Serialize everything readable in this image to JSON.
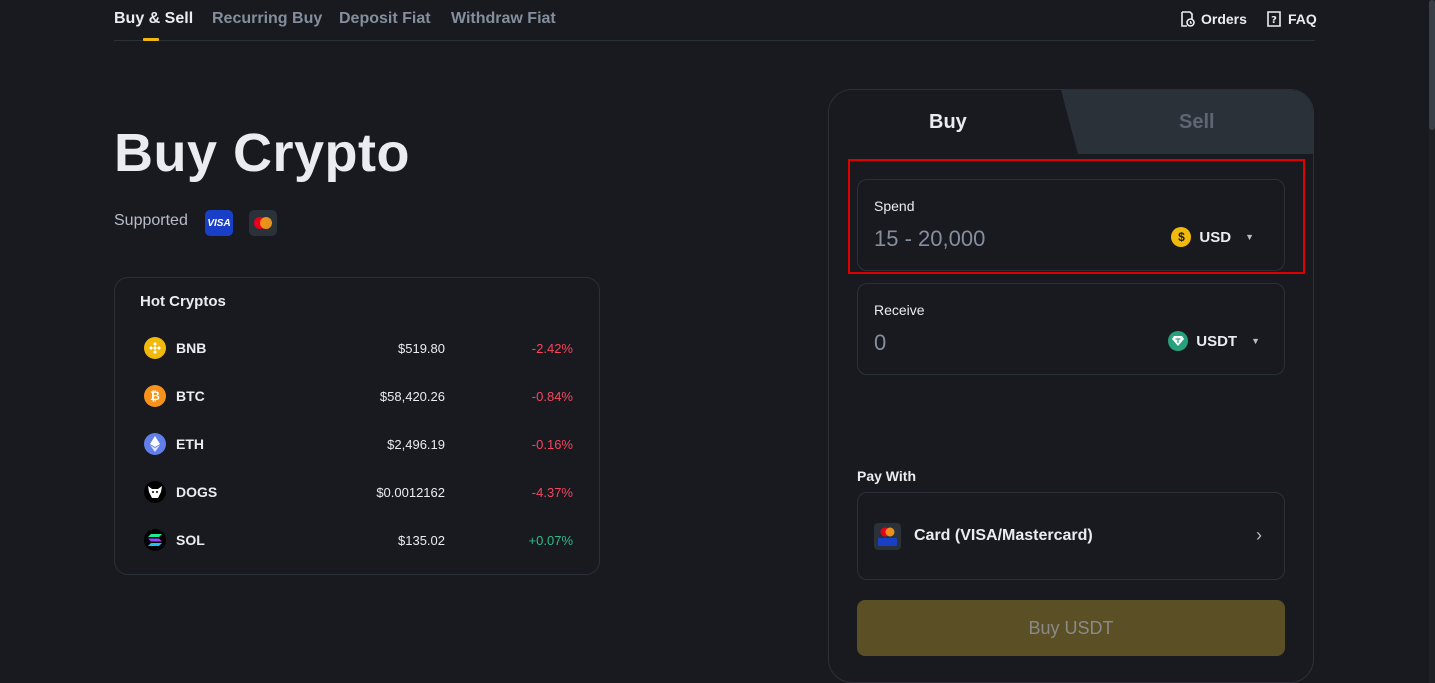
{
  "topnav": {
    "tabs": [
      {
        "label": "Buy & Sell",
        "active": true
      },
      {
        "label": "Recurring Buy",
        "active": false
      },
      {
        "label": "Deposit Fiat",
        "active": false
      },
      {
        "label": "Withdraw Fiat",
        "active": false
      }
    ],
    "orders_label": "Orders",
    "faq_label": "FAQ"
  },
  "hero": {
    "title": "Buy Crypto",
    "supported_label": "Supported",
    "visa_text": "VISA"
  },
  "hot_cryptos": {
    "title": "Hot Cryptos",
    "rows": [
      {
        "symbol": "BNB",
        "price": "$519.80",
        "change": "-2.42%",
        "color": "#f0b90b"
      },
      {
        "symbol": "BTC",
        "price": "$58,420.26",
        "change": "-0.84%",
        "color": "#f7931a"
      },
      {
        "symbol": "ETH",
        "price": "$2,496.19",
        "change": "-0.16%",
        "color": "#627eea"
      },
      {
        "symbol": "DOGS",
        "price": "$0.0012162",
        "change": "-4.37%",
        "color": "#000000"
      },
      {
        "symbol": "SOL",
        "price": "$135.02",
        "change": "+0.07%",
        "color": "#000000"
      }
    ]
  },
  "trade": {
    "buy_tab": "Buy",
    "sell_tab": "Sell",
    "spend": {
      "label": "Spend",
      "placeholder": "15 - 20,000",
      "currency": "USD"
    },
    "receive": {
      "label": "Receive",
      "value": "0",
      "currency": "USDT"
    },
    "pay_with_label": "Pay With",
    "pay_method": "Card (VISA/Mastercard)",
    "buy_button": "Buy USDT"
  },
  "colors": {
    "accent": "#f0b90b",
    "negative": "#f6465d",
    "positive": "#2ebd85",
    "highlight": "#e00000"
  }
}
